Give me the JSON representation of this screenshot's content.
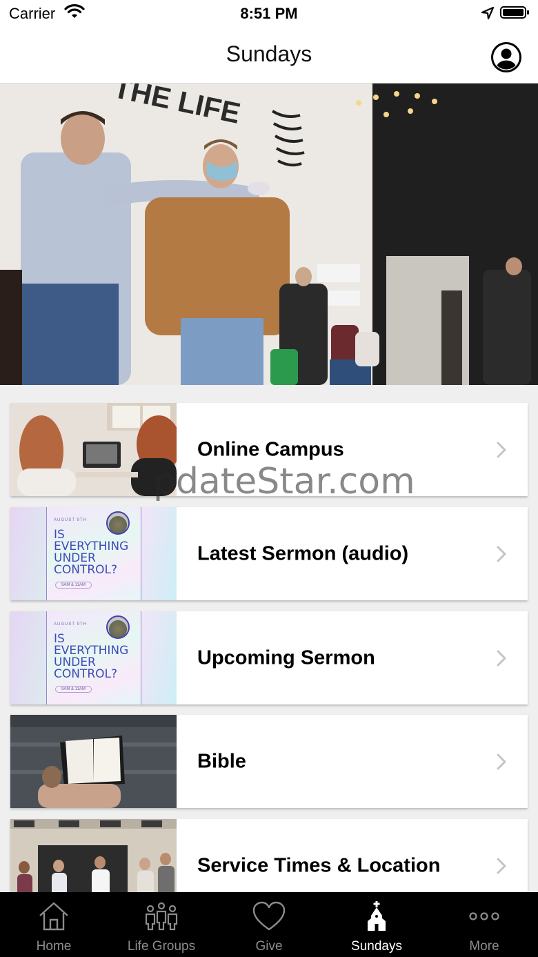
{
  "status_bar": {
    "carrier": "Carrier",
    "time": "8:51 PM"
  },
  "nav": {
    "title": "Sundays",
    "profile_icon": "person-circle-icon"
  },
  "hero": {
    "description_icon": "hero-photo",
    "wall_text": "THE LIFE"
  },
  "list": {
    "items": [
      {
        "label": "Online Campus",
        "thumbnail": "online-campus-photo"
      },
      {
        "label": "Latest Sermon (audio)",
        "thumbnail": "sermon-series-art"
      },
      {
        "label": "Upcoming Sermon",
        "thumbnail": "sermon-series-art"
      },
      {
        "label": "Bible",
        "thumbnail": "bible-photo"
      },
      {
        "label": "Service Times & Location",
        "thumbnail": "church-entrance-photo"
      }
    ],
    "poster": {
      "date": "AUGUST 9TH",
      "line1": "IS",
      "line2": "EVERYTHING",
      "line3": "UNDER",
      "line4": "CONTROL?",
      "times": "9AM & 11AM"
    }
  },
  "watermark": "pdateStar.com",
  "tabs": [
    {
      "label": "Home",
      "icon": "home-icon",
      "active": false
    },
    {
      "label": "Life Groups",
      "icon": "people-group-icon",
      "active": false
    },
    {
      "label": "Give",
      "icon": "heart-icon",
      "active": false
    },
    {
      "label": "Sundays",
      "icon": "church-icon",
      "active": true
    },
    {
      "label": "More",
      "icon": "more-dots-icon",
      "active": false
    }
  ],
  "colors": {
    "tab_bar_bg": "#000000",
    "tab_inactive": "#8c8c8c",
    "tab_active": "#ffffff",
    "card_bg": "#ffffff",
    "list_bg": "#efefef"
  }
}
